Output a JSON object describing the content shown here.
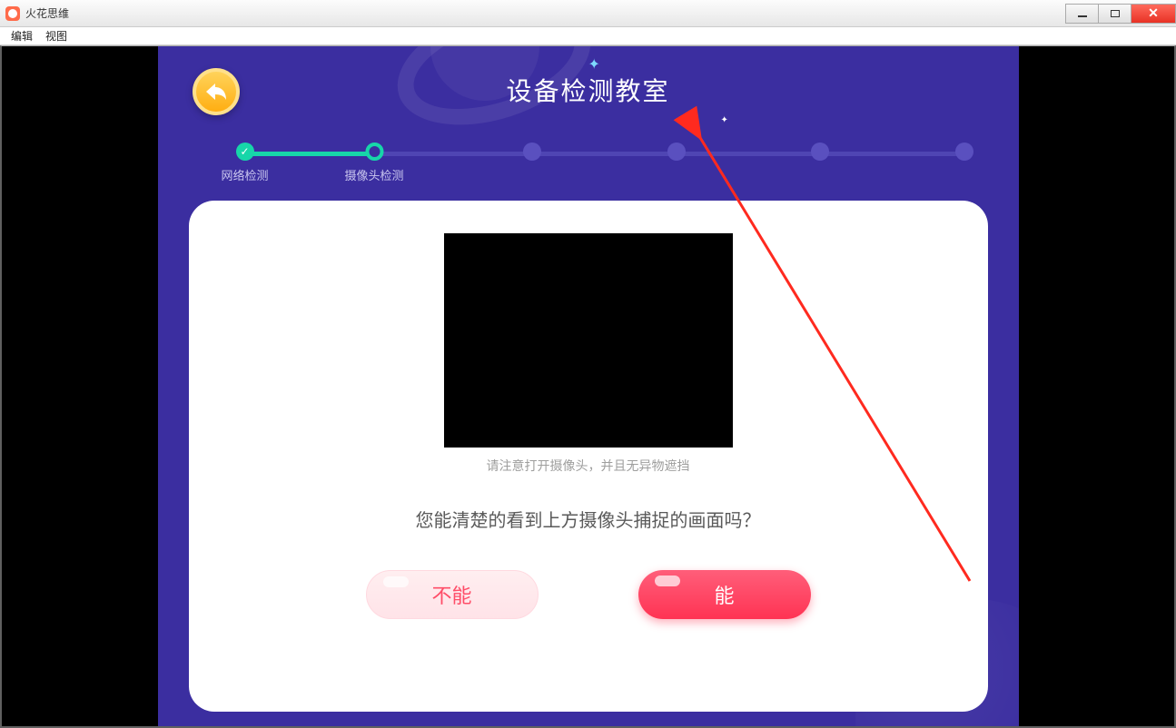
{
  "window": {
    "title": "火花思维"
  },
  "menubar": {
    "edit": "编辑",
    "view": "视图"
  },
  "stage": {
    "title": "设备检测教室",
    "steps": [
      {
        "label": "网络检测",
        "state": "done"
      },
      {
        "label": "摄像头检测",
        "state": "current"
      },
      {
        "label": "",
        "state": "pending"
      },
      {
        "label": "",
        "state": "pending"
      },
      {
        "label": "",
        "state": "pending"
      },
      {
        "label": "",
        "state": "pending"
      }
    ]
  },
  "card": {
    "hint": "请注意打开摄像头，并且无异物遮挡",
    "question": "您能清楚的看到上方摄像头捕捉的画面吗？",
    "no_label": "不能",
    "yes_label": "能"
  },
  "colors": {
    "accent_green": "#17d6a9",
    "stage_bg": "#3b2ea0",
    "danger_red": "#ff3353"
  }
}
